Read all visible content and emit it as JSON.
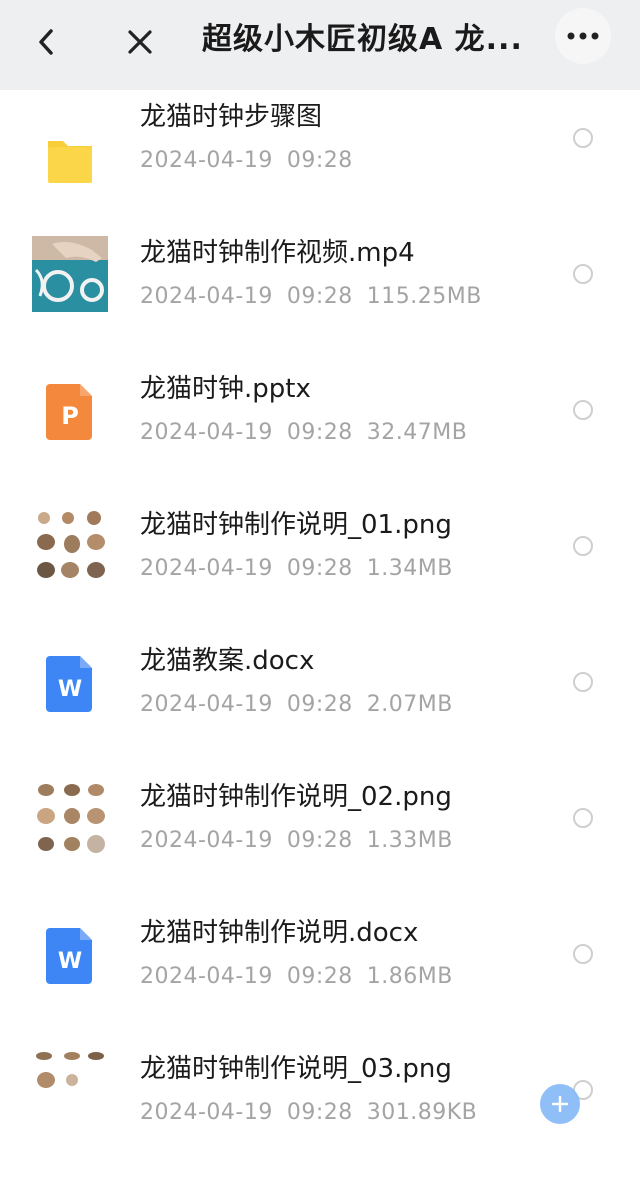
{
  "header": {
    "title": "超级小木匠初级A 龙...",
    "back_icon": "chevron-left-icon",
    "close_icon": "close-icon",
    "more_icon": "more-horizontal-icon"
  },
  "files": [
    {
      "name": "龙猫时钟步骤图",
      "date": "2024-04-19",
      "time": "09:28",
      "size": "",
      "type": "folder",
      "icon": "folder-icon"
    },
    {
      "name": "龙猫时钟制作视频.mp4",
      "date": "2024-04-19",
      "time": "09:28",
      "size": "115.25MB",
      "type": "video",
      "icon": "video-thumbnail"
    },
    {
      "name": "龙猫时钟.pptx",
      "date": "2024-04-19",
      "time": "09:28",
      "size": "32.47MB",
      "type": "pptx",
      "icon": "ppt-icon"
    },
    {
      "name": "龙猫时钟制作说明_01.png",
      "date": "2024-04-19",
      "time": "09:28",
      "size": "1.34MB",
      "type": "image",
      "icon": "image-thumbnail"
    },
    {
      "name": "龙猫教案.docx",
      "date": "2024-04-19",
      "time": "09:28",
      "size": "2.07MB",
      "type": "docx",
      "icon": "word-icon"
    },
    {
      "name": "龙猫时钟制作说明_02.png",
      "date": "2024-04-19",
      "time": "09:28",
      "size": "1.33MB",
      "type": "image",
      "icon": "image-thumbnail"
    },
    {
      "name": "龙猫时钟制作说明.docx",
      "date": "2024-04-19",
      "time": "09:28",
      "size": "1.86MB",
      "type": "docx",
      "icon": "word-icon"
    },
    {
      "name": "龙猫时钟制作说明_03.png",
      "date": "2024-04-19",
      "time": "09:28",
      "size": "301.89KB",
      "type": "image",
      "icon": "image-thumbnail"
    }
  ],
  "fab_icon": "plus-icon",
  "colors": {
    "folder": "#f8cf3a",
    "ppt": "#f4883c",
    "word": "#3e86f5",
    "fab": "#8bbcf7"
  }
}
